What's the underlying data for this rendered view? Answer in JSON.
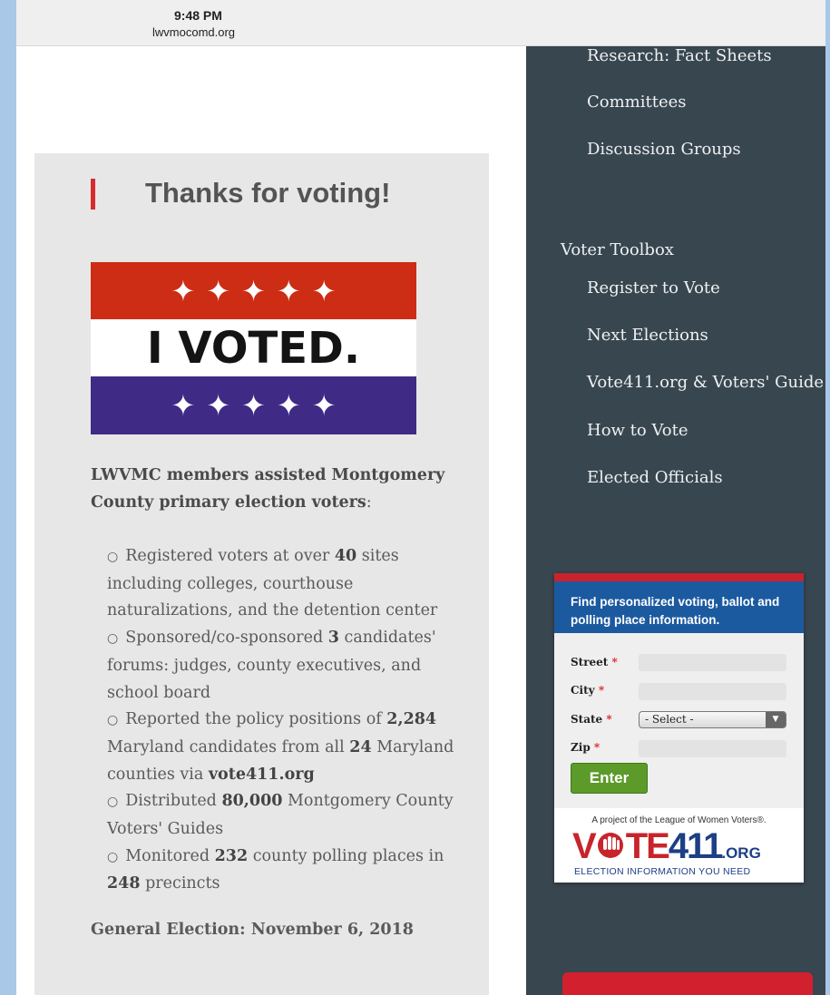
{
  "status": {
    "time": "9:48 PM",
    "url": "lwvmocomd.org"
  },
  "card": {
    "title": "Thanks for voting!",
    "image_text": "I VOTED.",
    "intro_bold": "LWVMC members assisted Montgomery County primary election voters",
    "intro_tail": ":",
    "bullets": [
      {
        "parts": [
          {
            "t": "Registered voters at over "
          },
          {
            "b": "40"
          },
          {
            "t": " sites including colleges, courthouse naturalizations, and the detention center"
          }
        ]
      },
      {
        "parts": [
          {
            "t": "Sponsored/co-sponsored "
          },
          {
            "b": "3"
          },
          {
            "t": " candidates' forums: judges, county executives, and school board"
          }
        ]
      },
      {
        "parts": [
          {
            "t": "Reported the policy positions of "
          },
          {
            "b": "2,284"
          },
          {
            "t": " Maryland candidates from all "
          },
          {
            "b": "24"
          },
          {
            "t": " Maryland counties via "
          },
          {
            "b": "vote411.org"
          }
        ]
      },
      {
        "parts": [
          {
            "t": "Distributed "
          },
          {
            "b": "80,000"
          },
          {
            "t": " Montgomery County Voters' Guides"
          }
        ]
      },
      {
        "parts": [
          {
            "t": "Monitored "
          },
          {
            "b": "232"
          },
          {
            "t": " county polling places in "
          },
          {
            "b": "248"
          },
          {
            "t": " precincts"
          }
        ]
      }
    ],
    "general_election": "General Election: November 6, 2018"
  },
  "sidebar": {
    "research_items": [
      "Research: Fact Sheets",
      "Committees",
      "Discussion Groups"
    ],
    "toolbox_title": "Voter Toolbox",
    "toolbox_items": [
      "Register to Vote",
      "Next Elections",
      "Vote411.org & Voters' Guide",
      "How to Vote",
      "Elected Officials"
    ]
  },
  "widget": {
    "header": "Find personalized voting, ballot and polling place information.",
    "fields": {
      "street": "Street",
      "city": "City",
      "state": "State",
      "zip": "Zip"
    },
    "required_mark": "*",
    "state_select": "- Select -",
    "enter_label": "Enter",
    "project_text": "A project of the League of Women Voters®.",
    "logo_v": "V",
    "logo_rest": "TE",
    "logo_num": "411",
    "logo_org": ".ORG",
    "tagline": "ELECTION INFORMATION YOU NEED"
  },
  "colors": {
    "accent_red": "#d62a2e",
    "sidebar": "#38464f",
    "widget_blue": "#1c5aa0",
    "enter_green": "#5c9a2a"
  },
  "icons": {
    "star": "star-icon",
    "select_arrow": "dropdown-arrow-icon",
    "ballot_logo": "ballot-hand-icon"
  }
}
